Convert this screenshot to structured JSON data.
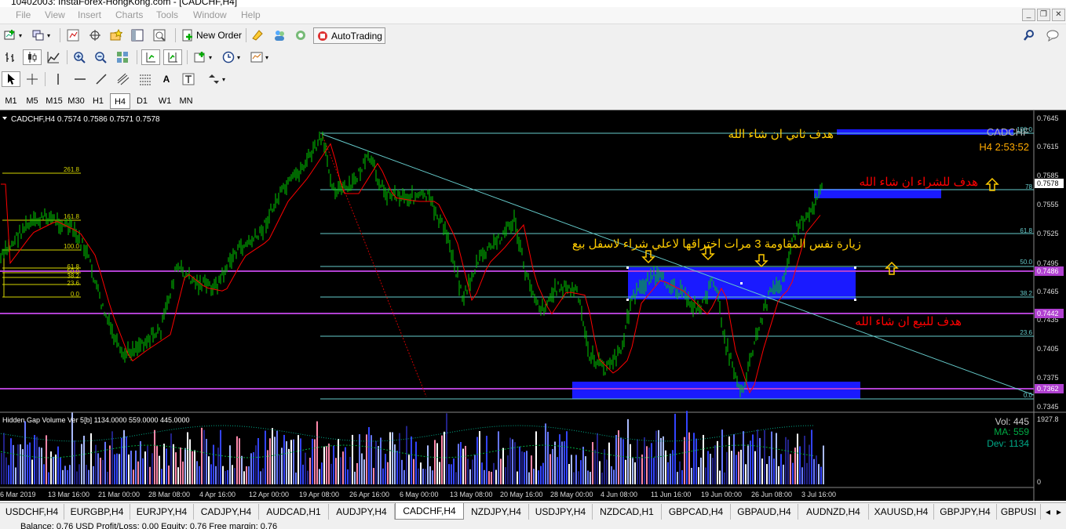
{
  "window": {
    "title": "10402003: InstaForex-HongKong.com - [CADCHF,H4]"
  },
  "menu": [
    "File",
    "View",
    "Insert",
    "Charts",
    "Tools",
    "Window",
    "Help"
  ],
  "toolbar": {
    "new_order": "New Order",
    "autotrading": "AutoTrading"
  },
  "timeframes": [
    "M1",
    "M5",
    "M15",
    "M30",
    "H1",
    "H4",
    "D1",
    "W1",
    "MN"
  ],
  "active_timeframe": "H4",
  "chart": {
    "header": "CADCHF,H4  0.7574 0.7586 0.7571 0.7578",
    "symbol_label": "CADCHF",
    "timer": "H4    2:53:52",
    "price_ticks": [
      "0.7645",
      "0.7615",
      "0.7585",
      "0.7555",
      "0.7525",
      "0.7495",
      "0.7465",
      "0.7435",
      "0.7405",
      "0.7375",
      "0.7345"
    ],
    "price_tags": [
      "0.7578",
      "0.7486",
      "0.7442",
      "0.7362"
    ],
    "fib_right": [
      "100.0",
      "78",
      "61.8",
      "50.0",
      "38.2",
      "23.6",
      "0.0"
    ],
    "fib_left": [
      "261.8",
      "161.8",
      "100.0",
      "61.8",
      "50.0",
      "38.2",
      "23.6",
      "0.0"
    ],
    "notes": {
      "target2": "هدف ثاني ان شاء الله",
      "buy_target": "هدف للشراء ان شاء الله",
      "resistance": "زيارة نفس المقاومة 3 مرات اختراقها لاعلي شراء لاسفل بيع",
      "sell_target": "هدف للبيع ان شاء الله"
    },
    "dates": [
      "6 Mar 2019",
      "13 Mar 16:00",
      "21 Mar 00:00",
      "28 Mar 08:00",
      "4 Apr 16:00",
      "12 Apr 00:00",
      "19 Apr 08:00",
      "26 Apr 16:00",
      "6 May 00:00",
      "13 May 08:00",
      "20 May 16:00",
      "28 May 00:00",
      "4 Jun 08:00",
      "11 Jun 16:00",
      "19 Jun 00:00",
      "26 Jun 08:00",
      "3 Jul 16:00"
    ]
  },
  "indicator": {
    "header": "Hidden Gap Volume Ver 5[b] 1134.0000 559.0000 445.0000",
    "vol": "Vol:  445",
    "ma": "MA:  559",
    "dev": "Dev: 1134",
    "ticks": [
      "1927.8",
      "0"
    ]
  },
  "tabs": [
    "USDCHF,H4",
    "EURGBP,H4",
    "EURJPY,H4",
    "CADJPY,H4",
    "AUDCAD,H1",
    "AUDJPY,H4",
    "CADCHF,H4",
    "NZDJPY,H4",
    "USDJPY,H4",
    "NZDCAD,H1",
    "GBPCAD,H4",
    "GBPAUD,H4",
    "AUDNZD,H4",
    "XAUUSD,H4",
    "GBPJPY,H4",
    "GBPUSI"
  ],
  "active_tab": "CADCHF,H4",
  "status": "Balance: 0.76 USD  Profit/Loss: 0.00  Equity: 0.76  Free margin: 0.76",
  "colors": {
    "bg": "#000000",
    "bull": "#00cc00",
    "ma": "#ff0000",
    "fib": "#66cccc",
    "zone": "#1a1aff",
    "purple": "#b040d0",
    "note_yellow": "#ffcc00",
    "note_red": "#ff0000"
  }
}
